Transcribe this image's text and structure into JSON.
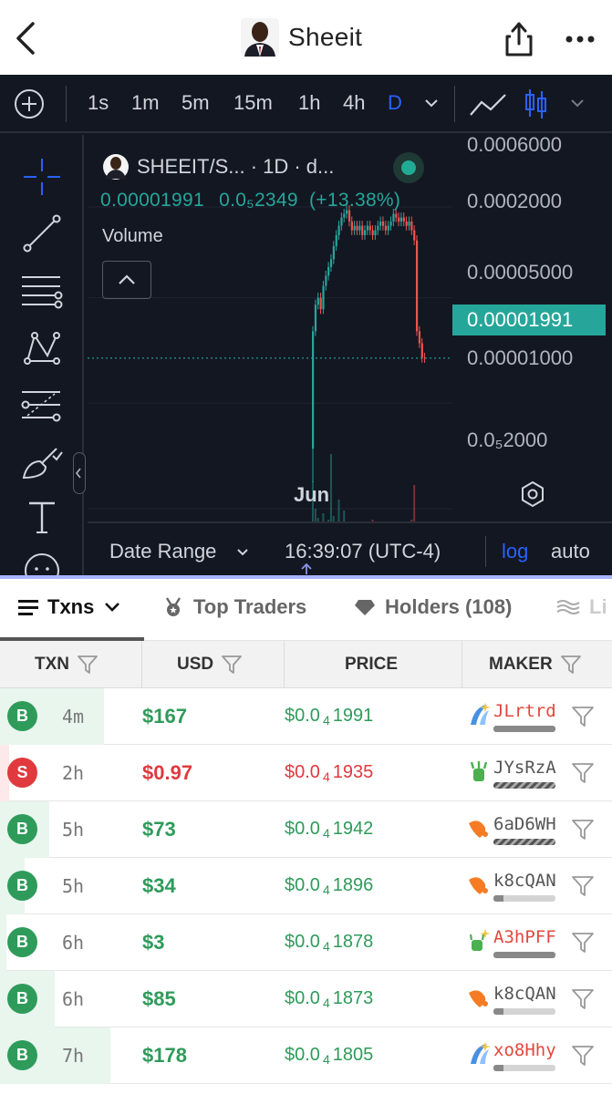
{
  "header": {
    "title": "Sheeit"
  },
  "toolbar": {
    "intervals": [
      "1s",
      "1m",
      "5m",
      "15m",
      "1h",
      "4h",
      "D"
    ],
    "active_interval": "D",
    "accent": "#2962ff"
  },
  "chart": {
    "symbol_label": "SHEEIT/S... · 1D · d...",
    "last_price": "0.00001991",
    "change_abs": "0.0₅2349",
    "change_pct": "(+13.38%)",
    "volume_label": "Volume",
    "price_tag": "0.00001991",
    "axis_labels": [
      "0.0006000",
      "0.0002000",
      "0.00005000",
      "0.00001000",
      "0.0₅2000"
    ],
    "month_label": "Jun",
    "date_range_label": "Date Range",
    "time_label": "16:39:07 (UTC-4)",
    "log_label": "log",
    "auto_label": "auto",
    "up_color": "#26a69a",
    "down_color": "#ef5350"
  },
  "chart_data": {
    "type": "candlestick",
    "scale": "log",
    "ylim": [
      2e-06,
      0.0006
    ],
    "y_ticks": [
      "0.0006000",
      "0.0002000",
      "0.00005000",
      "0.00001000",
      "0.0₅2000"
    ],
    "x_ticks": [
      "Jun"
    ],
    "last_price": 1.991e-05
  },
  "tabs": [
    {
      "label": "Txns",
      "active": true
    },
    {
      "label": "Top Traders",
      "active": false
    },
    {
      "label": "Holders (108)",
      "active": false
    },
    {
      "label": "Li",
      "active": false
    }
  ],
  "table": {
    "headers": [
      "TXN",
      "USD",
      "PRICE",
      "MAKER"
    ],
    "buy_color": "#2e9b5a",
    "sell_color": "#e0393e",
    "rows": [
      {
        "side": "B",
        "age": "4m",
        "usd": "$167",
        "price_pre": "$0.0",
        "price_sub": "4",
        "price_post": "1991",
        "maker": "JLrtrd",
        "bar": 1.0,
        "bgw": 0.17
      },
      {
        "side": "S",
        "age": "2h",
        "usd": "$0.97",
        "price_pre": "$0.0",
        "price_sub": "4",
        "price_post": "1935",
        "maker": "JYsRzA",
        "bar": 1.0,
        "bgw": 0.015
      },
      {
        "side": "B",
        "age": "5h",
        "usd": "$73",
        "price_pre": "$0.0",
        "price_sub": "4",
        "price_post": "1942",
        "maker": "6aD6WH",
        "bar": 1.0,
        "bgw": 0.08
      },
      {
        "side": "B",
        "age": "5h",
        "usd": "$34",
        "price_pre": "$0.0",
        "price_sub": "4",
        "price_post": "1896",
        "maker": "k8cQAN",
        "bar": 0.16,
        "bgw": 0.04
      },
      {
        "side": "B",
        "age": "6h",
        "usd": "$3",
        "price_pre": "$0.0",
        "price_sub": "4",
        "price_post": "1878",
        "maker": "A3hPFF",
        "bar": 1.0,
        "bgw": 0.01
      },
      {
        "side": "B",
        "age": "6h",
        "usd": "$85",
        "price_pre": "$0.0",
        "price_sub": "4",
        "price_post": "1873",
        "maker": "k8cQAN",
        "bar": 0.16,
        "bgw": 0.09
      },
      {
        "side": "B",
        "age": "7h",
        "usd": "$178",
        "price_pre": "$0.0",
        "price_sub": "4",
        "price_post": "1805",
        "maker": "xo8Hhy",
        "bar": 0.16,
        "bgw": 0.18
      }
    ]
  }
}
